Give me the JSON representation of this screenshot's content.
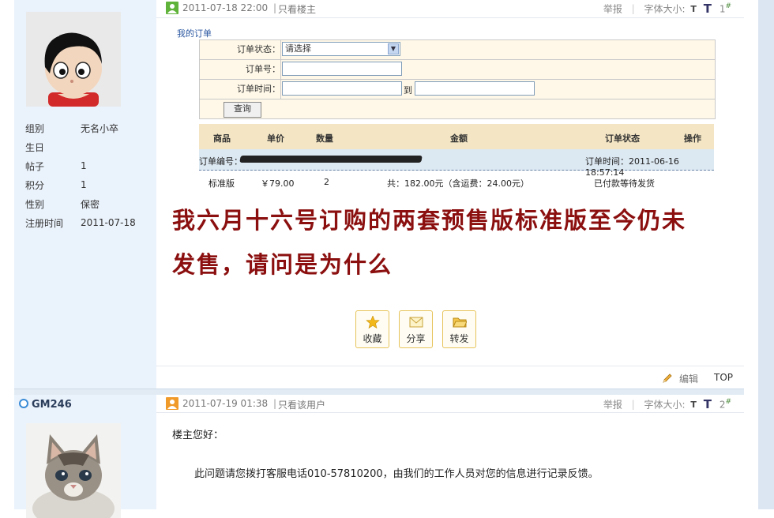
{
  "post1": {
    "time": "2011-07-18 22:00",
    "only_link": "只看楼主",
    "report": "举报",
    "font_size_label": "字体大小:",
    "font_small": "T",
    "font_big": "T",
    "floor": "1",
    "floor_sup": "#",
    "user": {
      "info": [
        {
          "k": "组别",
          "v": "无名小卒"
        },
        {
          "k": "生日",
          "v": ""
        },
        {
          "k": "帖子",
          "v": "1"
        },
        {
          "k": "积分",
          "v": "1"
        },
        {
          "k": "性别",
          "v": "保密"
        },
        {
          "k": "注册时间",
          "v": "2011-07-18"
        }
      ]
    },
    "screenshot": {
      "title": "我的订单",
      "form": {
        "status_label": "订单状态：",
        "status_value": "请选择",
        "order_no_label": "订单号：",
        "order_time_label": "订单时间：",
        "to_label": "到",
        "query_button": "查询"
      },
      "table_headers": [
        "商品",
        "单价",
        "数量",
        "金额",
        "订单状态",
        "操作"
      ],
      "order_no_label": "订单编号：",
      "order_time": "订单时间：2011-06-16 18:57:14",
      "row": {
        "product": "标准版",
        "price": "￥79.00",
        "qty": "2",
        "amount": "共：182.00元（含运费：24.00元）",
        "status": "已付款等待发货"
      }
    },
    "message_line1": "我六月十六号订购的两套预售版标准版至今仍未",
    "message_line2": "发售，请问是为什么",
    "actions": [
      "收藏",
      "分享",
      "转发"
    ],
    "edit": "编辑",
    "top": "TOP"
  },
  "post2": {
    "username": "GM246",
    "time": "2011-07-19 01:38",
    "only_link": "只看该用户",
    "report": "举报",
    "font_size_label": "字体大小:",
    "font_small": "T",
    "font_big": "T",
    "floor": "2",
    "floor_sup": "#",
    "greeting": "楼主您好：",
    "body": "此问题请您拨打客服电话010-57810200，由我们的工作人员对您的信息进行记录反馈。"
  },
  "colors": {
    "sidebar_bg": "#eaf2fb",
    "message_red": "#8b0f0f",
    "order_header": "#f4e6c4",
    "action_border": "#e6c35a"
  }
}
